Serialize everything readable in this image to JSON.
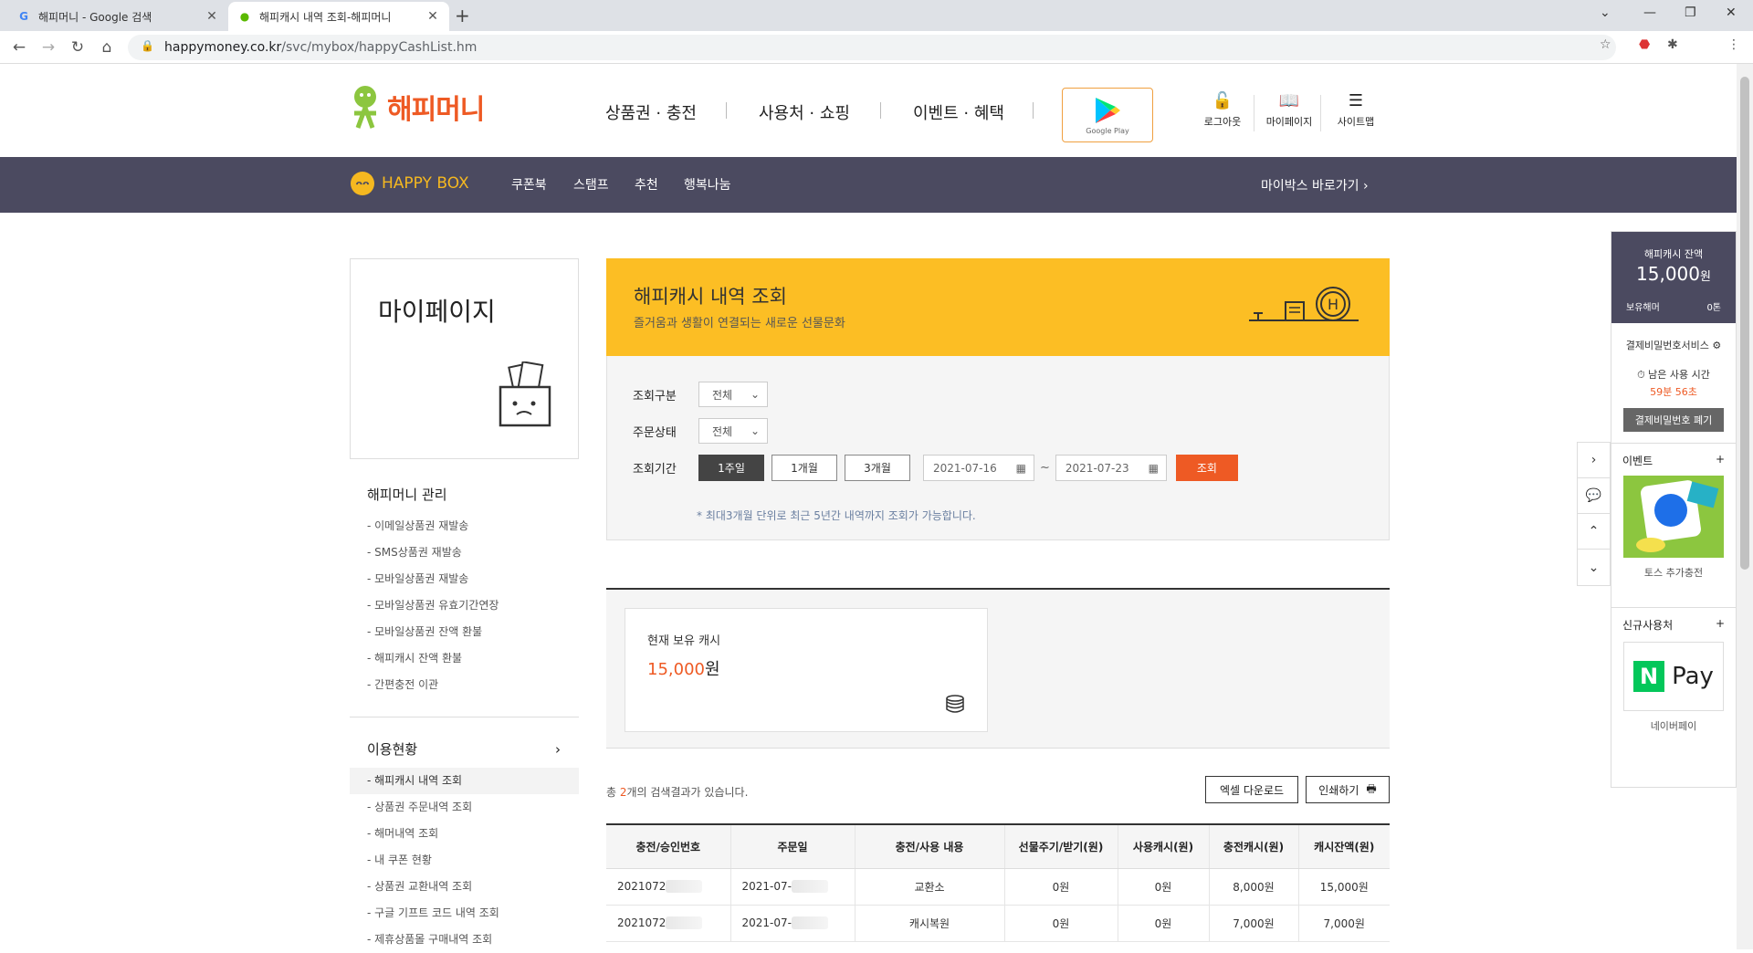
{
  "browser": {
    "tabs": [
      {
        "title": "해피머니 - Google 검색",
        "favicon": "G"
      },
      {
        "title": "해피캐시 내역 조회-해피머니",
        "favicon": "H"
      }
    ],
    "url_host": "happymoney.co.kr",
    "url_path": "/svc/mybox/happyCashList.hm"
  },
  "header": {
    "logo": "해피머니",
    "gnb": [
      "상품권 · 충전",
      "사용처 · 쇼핑",
      "이벤트 · 혜택"
    ],
    "gplay": "Google Play",
    "util": [
      "로그아웃",
      "마이페이지",
      "사이트맵"
    ]
  },
  "subnav": {
    "brand": "HAPPY BOX",
    "items": [
      "쿠폰북",
      "스탬프",
      "추천",
      "행복나눔"
    ],
    "right": "마이박스 바로가기 ›"
  },
  "sidebar": {
    "title": "마이페이지",
    "sec1": "해피머니 관리",
    "items1": [
      "- 이메일상품권 재발송",
      "- SMS상품권 재발송",
      "- 모바일상품권 재발송",
      "- 모바일상품권 유효기간연장",
      "- 모바일상품권 잔액 환불",
      "- 해피캐시 잔액 환불",
      "- 간편충전 이관"
    ],
    "sec2": "이용현황",
    "items2": [
      "- 해피캐시 내역 조회",
      "- 상품권 주문내역 조회",
      "- 해머내역 조회",
      "- 내 쿠폰 현황",
      "- 상품권 교환내역 조회",
      "- 구글 기프트 코드 내역 조회",
      "- 제휴상품몰 구매내역 조회"
    ]
  },
  "banner": {
    "title": "해피캐시 내역 조회",
    "subtitle": "즐거움과 생활이 연결되는 새로운 선물문화",
    "badge": "H"
  },
  "search": {
    "type_label": "조회구분",
    "type_value": "전체",
    "status_label": "주문상태",
    "status_value": "전체",
    "period_label": "조회기간",
    "periods": [
      "1주일",
      "1개월",
      "3개월"
    ],
    "date_from": "2021-07-16",
    "date_to": "2021-07-23",
    "tilde": "~",
    "submit": "조회",
    "note": "* 최대3개월 단위로 최근 5년간 내역까지 조회가 가능합니다."
  },
  "cash": {
    "label": "현재 보유 캐시",
    "amount": "15,000",
    "unit": "원"
  },
  "results": {
    "prefix": "총 ",
    "count": "2",
    "suffix": "개의 검색결과가 있습니다.",
    "excel": "엑셀 다운로드",
    "print": "인쇄하기"
  },
  "table": {
    "headers": [
      "충전/승인번호",
      "주문일",
      "충전/사용 내용",
      "선물주기/받기(원)",
      "사용캐시(원)",
      "충전캐시(원)",
      "캐시잔액(원)"
    ],
    "rows": [
      [
        "2021072",
        "2021-07-",
        "교환소",
        "0원",
        "0원",
        "8,000원",
        "15,000원"
      ],
      [
        "2021072",
        "2021-07-",
        "캐시복원",
        "0원",
        "0원",
        "7,000원",
        "7,000원"
      ]
    ]
  },
  "quickside": {
    "balance_label": "해피캐시 잔액",
    "balance": "15,000",
    "balance_unit": "원",
    "coupon_label": "보유해머",
    "coupon_value": "0톤",
    "pw_service": "결제비밀번호서비스 ⚙",
    "time_label": "남은 사용 시간",
    "time_value": "59분 56초",
    "pw_btn": "결제비밀번호 폐기",
    "event_label": "이벤트",
    "event_caption": "토스 추가충전",
    "new_label": "신규사용처",
    "new_caption": "네이버페이",
    "plus": "+",
    "npay_n": "N",
    "npay_text": "Pay"
  }
}
